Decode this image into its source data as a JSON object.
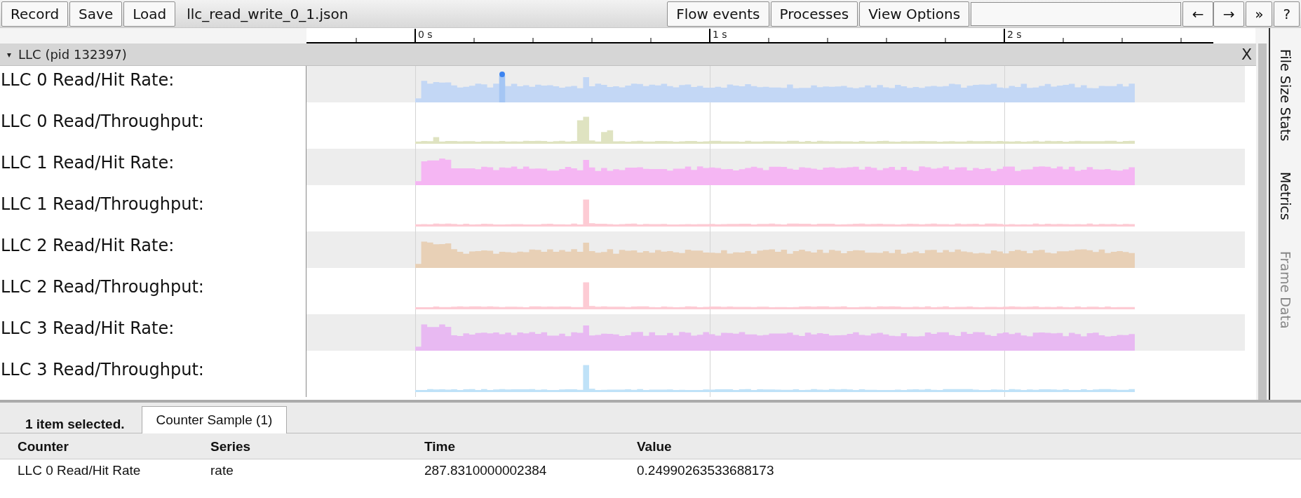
{
  "toolbar": {
    "left_buttons": [
      "Record",
      "Save",
      "Load"
    ],
    "filename": "llc_read_write_0_1.json",
    "right_buttons": [
      "Flow events",
      "Processes",
      "View Options"
    ],
    "nav_buttons": [
      "←",
      "→"
    ],
    "more_button": "»",
    "help_button": "?"
  },
  "ruler": {
    "labels": [
      "0 s",
      "1 s",
      "2 s"
    ]
  },
  "process": {
    "toggle": "▾",
    "title": "LLC (pid 132397)",
    "close": "X"
  },
  "tracks": [
    {
      "label": "LLC 0 Read/Hit Rate:",
      "kind": "rate",
      "color": "#c3d7f5",
      "highlighted": true
    },
    {
      "label": "LLC 0 Read/Throughput:",
      "kind": "throughput",
      "color": "#dfe3c1",
      "highlighted": false
    },
    {
      "label": "LLC 1 Read/Hit Rate:",
      "kind": "rate",
      "color": "#f5b6f3",
      "highlighted": false
    },
    {
      "label": "LLC 1 Read/Throughput:",
      "kind": "throughput",
      "color": "#fdcbd4",
      "highlighted": false
    },
    {
      "label": "LLC 2 Read/Hit Rate:",
      "kind": "rate",
      "color": "#e8d0b6",
      "highlighted": false
    },
    {
      "label": "LLC 2 Read/Throughput:",
      "kind": "throughput",
      "color": "#fdcbd4",
      "highlighted": false
    },
    {
      "label": "LLC 3 Read/Hit Rate:",
      "kind": "rate",
      "color": "#e8b9f2",
      "highlighted": false
    },
    {
      "label": "LLC 3 Read/Throughput:",
      "kind": "throughput",
      "color": "#bfe2f8",
      "highlighted": false
    }
  ],
  "side_tabs": [
    {
      "label": "File Size Stats",
      "disabled": false
    },
    {
      "label": "Metrics",
      "disabled": false
    },
    {
      "label": "Frame Data",
      "disabled": true
    }
  ],
  "analysis": {
    "summary": "1 item selected.",
    "tabs": [
      {
        "label": "Counter Sample (1)",
        "selected": true
      }
    ],
    "table": {
      "columns": [
        "Counter",
        "Series",
        "Time",
        "Value"
      ],
      "rows": [
        [
          "LLC 0 Read/Hit Rate",
          "rate",
          "287.8310000002384",
          "0.24990263533688173"
        ]
      ]
    }
  }
}
